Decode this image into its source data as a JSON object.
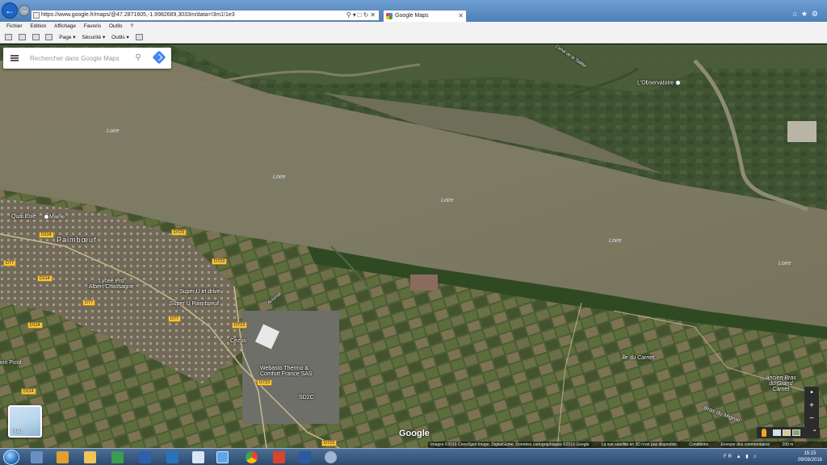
{
  "browser": {
    "url": "https://www.google.fr/maps/@47.2871605,-1.9982689,3033m/data=!3m1!1e3",
    "tab_title": "Google Maps",
    "menu": [
      "Fichier",
      "Edition",
      "Affichage",
      "Favoris",
      "Outils",
      "?"
    ],
    "commands": [
      "Page ▾",
      "Sécurité ▾",
      "Outils ▾"
    ]
  },
  "search": {
    "placeholder": "Rechercher dans Google Maps"
  },
  "map": {
    "river_labels": [
      "Loire",
      "Loire",
      "Loire",
      "Loire",
      "Loire"
    ],
    "places": {
      "observatoire": "L'Observatoire",
      "quai": "Quai Eole",
      "mairie": "Mairie",
      "paimboeuf": "Paimbœuf",
      "lycee": "Lycée Pro\nAlbert Chassagne",
      "super_u_drive": "Super U et drive",
      "super_u": "Super U Paimboeuf",
      "cezus": "Cezus",
      "webasto": "Webasto Thermo &\nComfort France SAS",
      "sd2c": "SD2C",
      "picot": "ion Picot",
      "ile_carnet": "Île du Carnet",
      "ancien_bras": "Ancien Bras\ndu Grand\nCarnet",
      "bras_migron": "Bras du Migron",
      "canal": "Canal de la Taillée",
      "achenal": "Achenal"
    },
    "roads": {
      "d723_a": "D723",
      "d723_b": "D723",
      "d723_c": "D723",
      "d723_d": "D723",
      "d723_e": "D723",
      "d114_a": "D114",
      "d114_b": "D114",
      "d114_c": "D114",
      "d114_d": "D114",
      "d77_a": "D77",
      "d77_b": "D77",
      "d77_c": "D77"
    },
    "plan_label": "Plan",
    "google_logo": "Google",
    "attribution": "Images ©2016 Cnes/Spot Image, DigitalGlobe, Données cartographiques ©2016 Google",
    "attribution_links": [
      "La vue satellite en 3D n'est pas disponible",
      "Conditions",
      "Envoyer des commentaires",
      "200 m"
    ],
    "zoom_in": "+",
    "zoom_out": "−"
  },
  "taskbar": {
    "lang": "FR",
    "time": "15:15",
    "date": "09/08/2016"
  }
}
